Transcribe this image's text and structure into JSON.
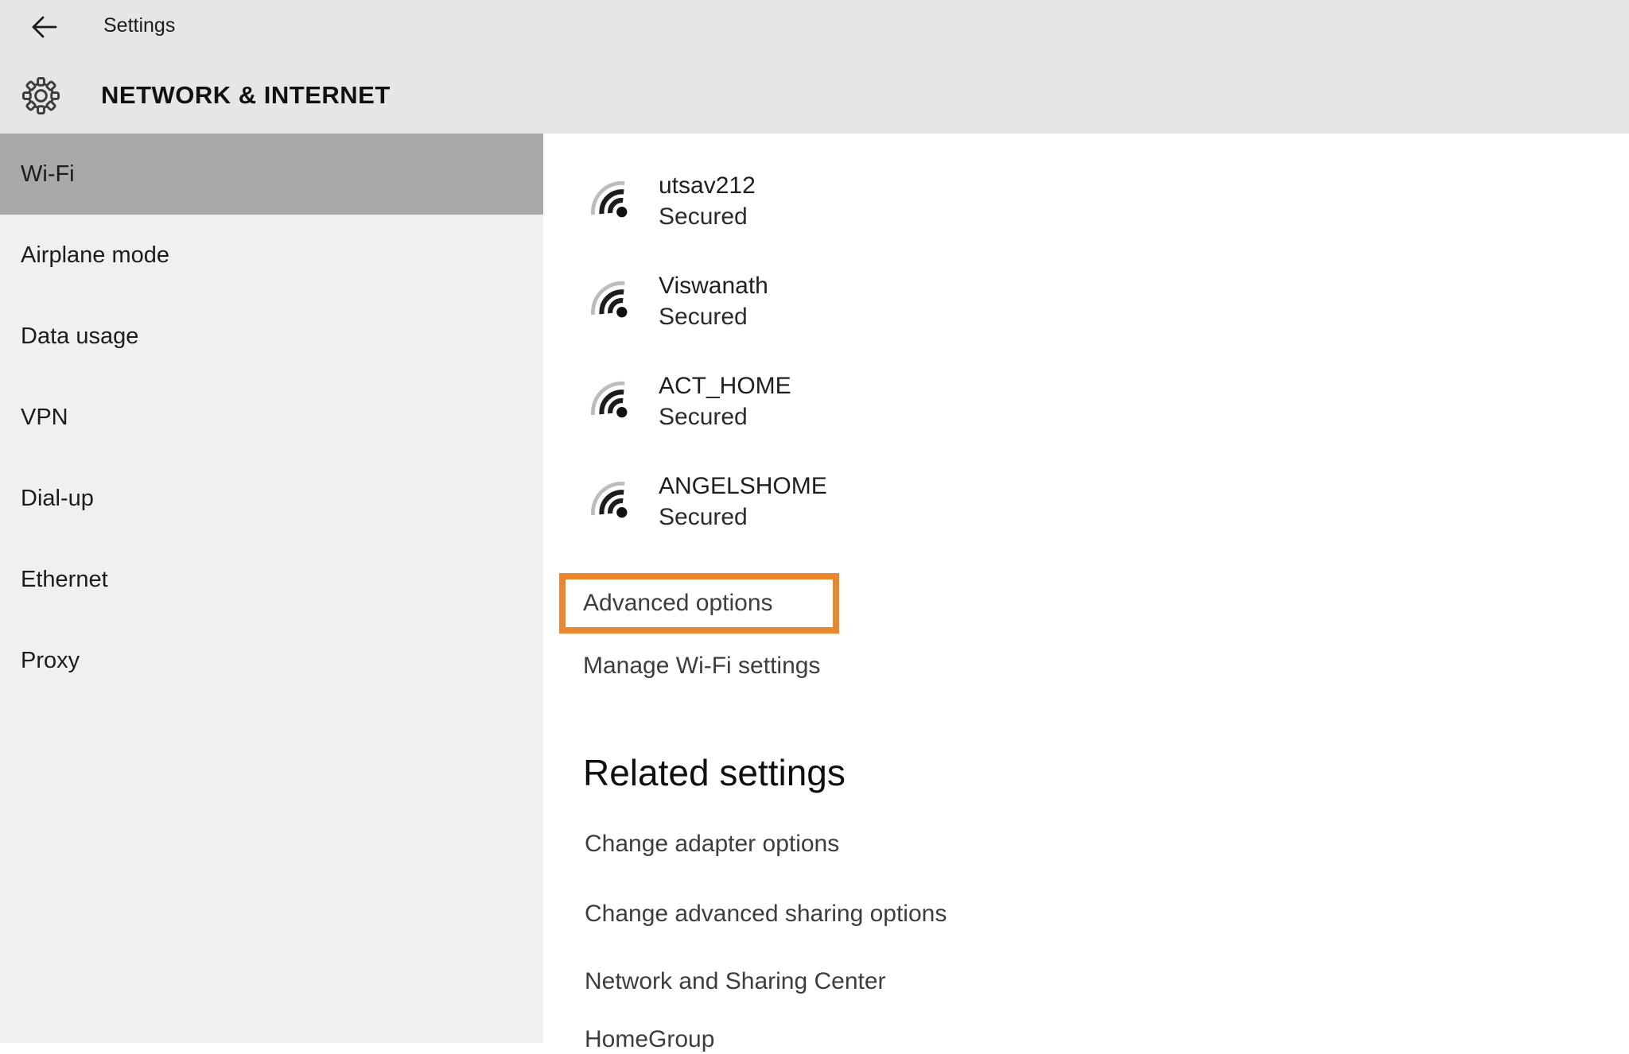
{
  "header": {
    "back_label": "Settings",
    "page_title": "NETWORK & INTERNET"
  },
  "sidebar": {
    "items": [
      {
        "label": "Wi-Fi",
        "selected": true
      },
      {
        "label": "Airplane mode"
      },
      {
        "label": "Data usage"
      },
      {
        "label": "VPN"
      },
      {
        "label": "Dial-up"
      },
      {
        "label": "Ethernet"
      },
      {
        "label": "Proxy"
      }
    ]
  },
  "wifi": {
    "networks": [
      {
        "name": "utsav212",
        "status": "Secured"
      },
      {
        "name": "Viswanath",
        "status": "Secured"
      },
      {
        "name": "ACT_HOME",
        "status": "Secured"
      },
      {
        "name": "ANGELSHOME",
        "status": "Secured"
      }
    ],
    "advanced_options_label": "Advanced options",
    "manage_label": "Manage Wi-Fi settings"
  },
  "related": {
    "heading": "Related settings",
    "links": [
      "Change adapter options",
      "Change advanced sharing options",
      "Network and Sharing Center",
      "HomeGroup"
    ]
  },
  "colors": {
    "annotation_orange": "#e8872f",
    "selected_gray": "#a9a9a9",
    "header_bg": "#e6e6e6",
    "sidebar_bg": "#f0f0f0"
  }
}
